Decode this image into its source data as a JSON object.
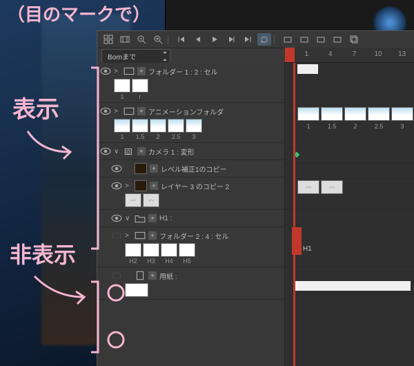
{
  "annotations": {
    "top": "（目のマークで）",
    "visible": "表示",
    "hidden": "非表示"
  },
  "toolbar": {
    "icons": [
      "thumbnails",
      "filmstrip",
      "zoom-out",
      "zoom-in",
      "prev-end",
      "prev",
      "play",
      "next",
      "next-end",
      "loop",
      "onion1",
      "onion2",
      "onion3",
      "onion4",
      "stack"
    ]
  },
  "select": {
    "label": "Bornまで"
  },
  "ruler": {
    "numbers": [
      "1",
      "4",
      "7",
      "10",
      "13"
    ]
  },
  "layers": [
    {
      "id": "folder1",
      "visible": true,
      "expand": ">",
      "type": "filmstrip",
      "label": "フォルダー 1 : 2 : セル",
      "thumbs": [
        "1",
        "r"
      ],
      "tl_bar": true
    },
    {
      "id": "animfolder",
      "visible": true,
      "expand": ">",
      "type": "filmstrip",
      "label": "アニメーションフォルダ",
      "thumbs_anim": [
        "1",
        "1.5",
        "2",
        "2.5",
        "3"
      ],
      "tl_thumbs": [
        "1",
        "1.5",
        "2",
        "2.5",
        "3"
      ]
    },
    {
      "id": "camera",
      "visible": true,
      "expand": "v",
      "type": "camera",
      "label": "カメラ 1 : 変形",
      "tl_key": true
    },
    {
      "id": "level",
      "visible": true,
      "expand": "",
      "type": "thumb-dark",
      "label": "レベル補正1のコピー",
      "indent": 1
    },
    {
      "id": "layer3",
      "visible": true,
      "expand": ">",
      "type": "thumb-dark",
      "label": "レイヤー 3 のコピー 2",
      "indent": 1,
      "wings": true
    },
    {
      "id": "h1",
      "visible": true,
      "expand": "v",
      "type": "folder",
      "label": "H1 :",
      "indent": 1
    },
    {
      "id": "folder2",
      "visible": false,
      "expand": ">",
      "type": "filmstrip",
      "label": "フォルダー 2 : 4 : セル",
      "indent": 1,
      "circled": true,
      "sublabels": [
        "H2",
        "H3",
        "H4",
        "H5"
      ],
      "tl_redbar": true,
      "tl_label": "H1"
    },
    {
      "id": "paper",
      "visible": false,
      "expand": "",
      "type": "paper",
      "label": "用紙 :",
      "indent": 1,
      "circled": true,
      "whitethumb": true
    }
  ]
}
